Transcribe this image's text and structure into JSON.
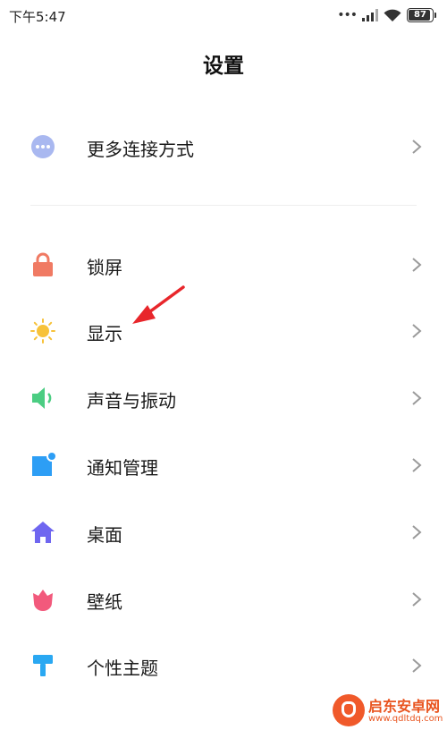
{
  "status_bar": {
    "time": "下午5:47",
    "battery": "87"
  },
  "header": {
    "title": "设置"
  },
  "items": [
    {
      "label": "更多连接方式",
      "icon": "more-connection-icon"
    },
    {
      "label": "锁屏",
      "icon": "lock-icon"
    },
    {
      "label": "显示",
      "icon": "sun-icon"
    },
    {
      "label": "声音与振动",
      "icon": "speaker-icon"
    },
    {
      "label": "通知管理",
      "icon": "notification-icon"
    },
    {
      "label": "桌面",
      "icon": "home-icon"
    },
    {
      "label": "壁纸",
      "icon": "tulip-icon"
    },
    {
      "label": "个性主题",
      "icon": "paint-roller-icon"
    }
  ],
  "colors": {
    "more": "#a9b8f0",
    "lock": "#f07a63",
    "sun": "#f7c23a",
    "speaker": "#4bcd82",
    "notify": "#2d9ef5",
    "home": "#6f66f0",
    "tulip": "#f2597c",
    "theme": "#2aa8f2",
    "chevron": "#9a9a9a",
    "annotation": "#e8262b"
  },
  "watermark": {
    "name": "启东安卓网",
    "url": "www.qdltdq.com"
  }
}
